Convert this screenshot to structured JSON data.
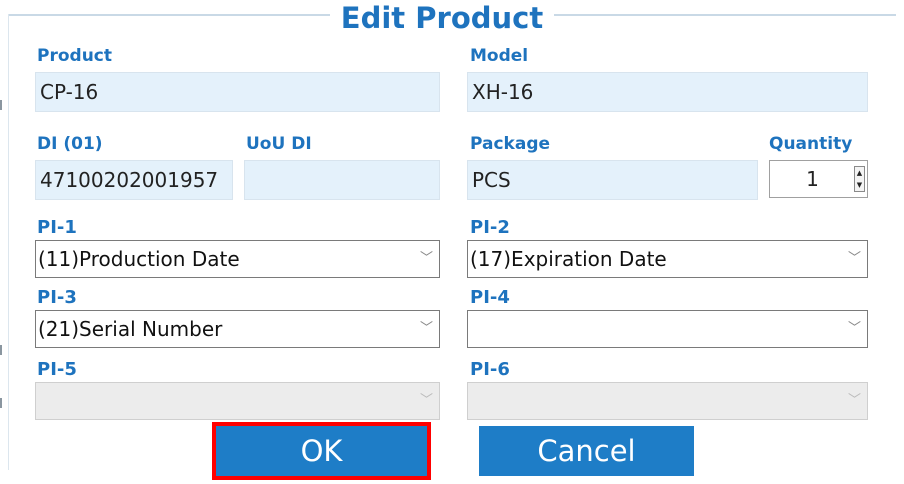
{
  "dialog": {
    "title": "Edit Product"
  },
  "fields": {
    "product": {
      "label": "Product",
      "value": "CP-16"
    },
    "model": {
      "label": "Model",
      "value": "XH-16"
    },
    "di": {
      "label": "DI (01)",
      "value": "47100202001957"
    },
    "uou_di": {
      "label": "UoU DI",
      "value": ""
    },
    "package": {
      "label": "Package",
      "value": "PCS"
    },
    "quantity": {
      "label": "Quantity",
      "value": "1"
    }
  },
  "pi": [
    {
      "label": "PI-1",
      "selected": "(11)Production Date",
      "enabled": true
    },
    {
      "label": "PI-2",
      "selected": "(17)Expiration Date",
      "enabled": true
    },
    {
      "label": "PI-3",
      "selected": "(21)Serial Number",
      "enabled": true
    },
    {
      "label": "PI-4",
      "selected": "",
      "enabled": true
    },
    {
      "label": "PI-5",
      "selected": "",
      "enabled": false
    },
    {
      "label": "PI-6",
      "selected": "",
      "enabled": false
    }
  ],
  "buttons": {
    "ok": "OK",
    "cancel": "Cancel"
  },
  "icons": {
    "dropdown": "chevron-down-icon",
    "spin_up": "spin-up-icon",
    "spin_down": "spin-down-icon"
  },
  "colors": {
    "accent": "#1e73be",
    "button": "#1e7dc7",
    "highlight": "#ff0000",
    "field_bg": "#e4f1fb"
  }
}
